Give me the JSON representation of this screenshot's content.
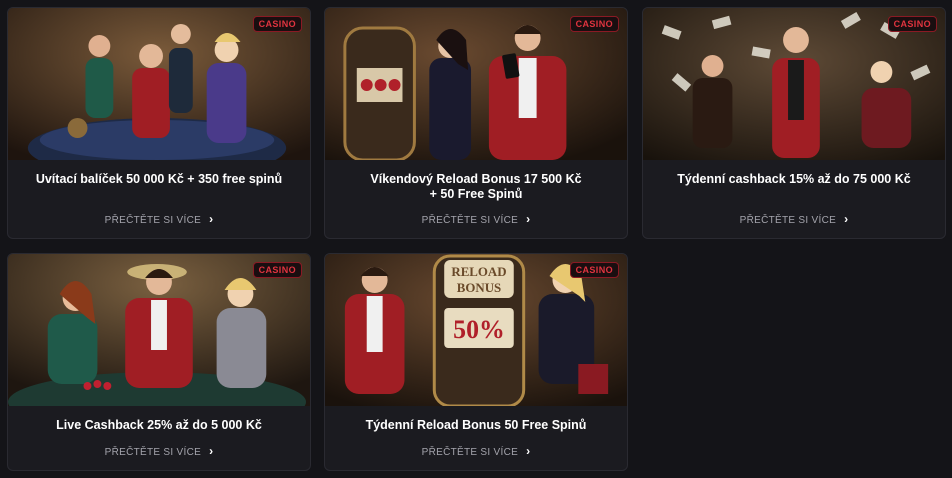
{
  "badge_label": "CASINO",
  "read_more_label": "PŘEČTĚTE SI VÍCE",
  "cards": [
    {
      "title_line1": "Uvítací balíček 50 000 Kč + 350 free spinů",
      "title_line2": "",
      "image": "casino-table-party"
    },
    {
      "title_line1": "Víkendový Reload Bonus 17 500 Kč",
      "title_line2": "+ 50 Free Spinů",
      "image": "slot-machine-couple"
    },
    {
      "title_line1": "Týdenní cashback 15% až do 75 000 Kč",
      "title_line2": "",
      "image": "money-rain"
    },
    {
      "title_line1": "Live Cashback 25% až do 5 000 Kč",
      "title_line2": "",
      "image": "poker-table-trio"
    },
    {
      "title_line1": "Týdenní Reload Bonus 50 Free Spinů",
      "title_line2": "",
      "image": "reload-bonus-slot"
    }
  ],
  "reload_slot_text": {
    "line1": "RELOAD",
    "line2": "BONUS",
    "reels": "50%"
  },
  "colors": {
    "page_bg": "#141418",
    "card_bg": "#1b1b20",
    "badge_red": "#e0343f",
    "accent_red": "#b0202a"
  }
}
